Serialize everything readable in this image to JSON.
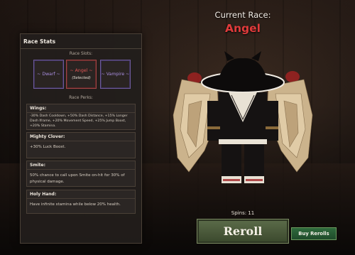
{
  "header": {
    "current_race_label": "Current Race:",
    "current_race_value": "Angel"
  },
  "panel": {
    "title": "Race Stats",
    "slots_label": "Race Slots:",
    "slots": [
      {
        "name": "~ Dwarf ~",
        "status": ""
      },
      {
        "name": "~ Angel ~",
        "status": "(Selected)"
      },
      {
        "name": "~ Vampire ~",
        "status": ""
      }
    ],
    "perks_label": "Race Perks:",
    "perks": [
      {
        "name": "Wings:",
        "description": "-30% Dash Cooldown, +50% Dash Distance, +15% Longer Dash Iframe, +20% Movement Speed, +25% Jump Boost, +20% Stamina."
      },
      {
        "name": "Mighty Clover:",
        "description": "+30% Luck Boost."
      },
      {
        "name": "Smite:",
        "description": "50% chance to call upon Smite on-hit for 30% of physical damage."
      },
      {
        "name": "Holy Hand:",
        "description": "Have infinite stamina while below 20% health."
      }
    ]
  },
  "controls": {
    "spins_text": "Spins: 11",
    "reroll_label": "Reroll",
    "buy_rerolls_label": "Buy Rerolls"
  },
  "colors": {
    "selected_race": "#e03b3b",
    "unselected_race": "#a98ee0",
    "reroll_button": "#4a5a3a",
    "buy_button": "#2a5a34"
  }
}
